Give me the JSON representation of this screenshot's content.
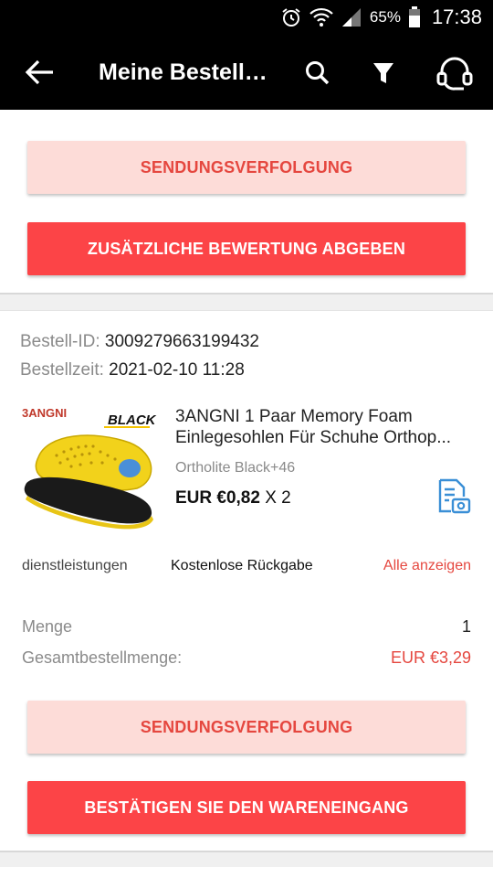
{
  "status_bar": {
    "battery_percent": "65%",
    "time": "17:38",
    "icons": [
      "alarm-icon",
      "wifi-icon",
      "signal-icon",
      "battery-icon"
    ]
  },
  "app_bar": {
    "title": "Meine Bestell…",
    "icons": [
      "back-arrow-icon",
      "search-icon",
      "filter-icon",
      "headset-icon"
    ]
  },
  "order_top": {
    "tracking_button": "SENDUNGSVERFOLGUNG",
    "review_button": "ZUSÄTZLICHE BEWERTUNG ABGEBEN"
  },
  "order": {
    "id_label": "Bestell-ID:",
    "id_value": "3009279663199432",
    "time_label": "Bestellzeit:",
    "time_value": "2021-02-10 11:28",
    "product": {
      "image_brand": "3ANGNI",
      "image_tag": "BLACK",
      "title_line1": "3ANGNI 1 Paar Memory Foam",
      "title_line2": "Einlegesohlen Für Schuhe Orthop...",
      "variant": "Ortholite Black+46",
      "price": "EUR €0,82",
      "quantity": "X 2"
    },
    "services_label": "dienstleistungen",
    "services_value": "Kostenlose Rückgabe",
    "services_link": "Alle anzeigen",
    "menge_label": "Menge",
    "menge_value": "1",
    "total_label": "Gesamtbestellmenge:",
    "total_value": "EUR €3,29",
    "tracking_button": "SENDUNGSVERFOLGUNG",
    "confirm_button": "BESTÄTIGEN SIE DEN WARENEINGANG"
  },
  "colors": {
    "accent": "#fc4447",
    "accent_text": "#e5473f",
    "light_button": "#fddcd8",
    "header": "#000000"
  }
}
